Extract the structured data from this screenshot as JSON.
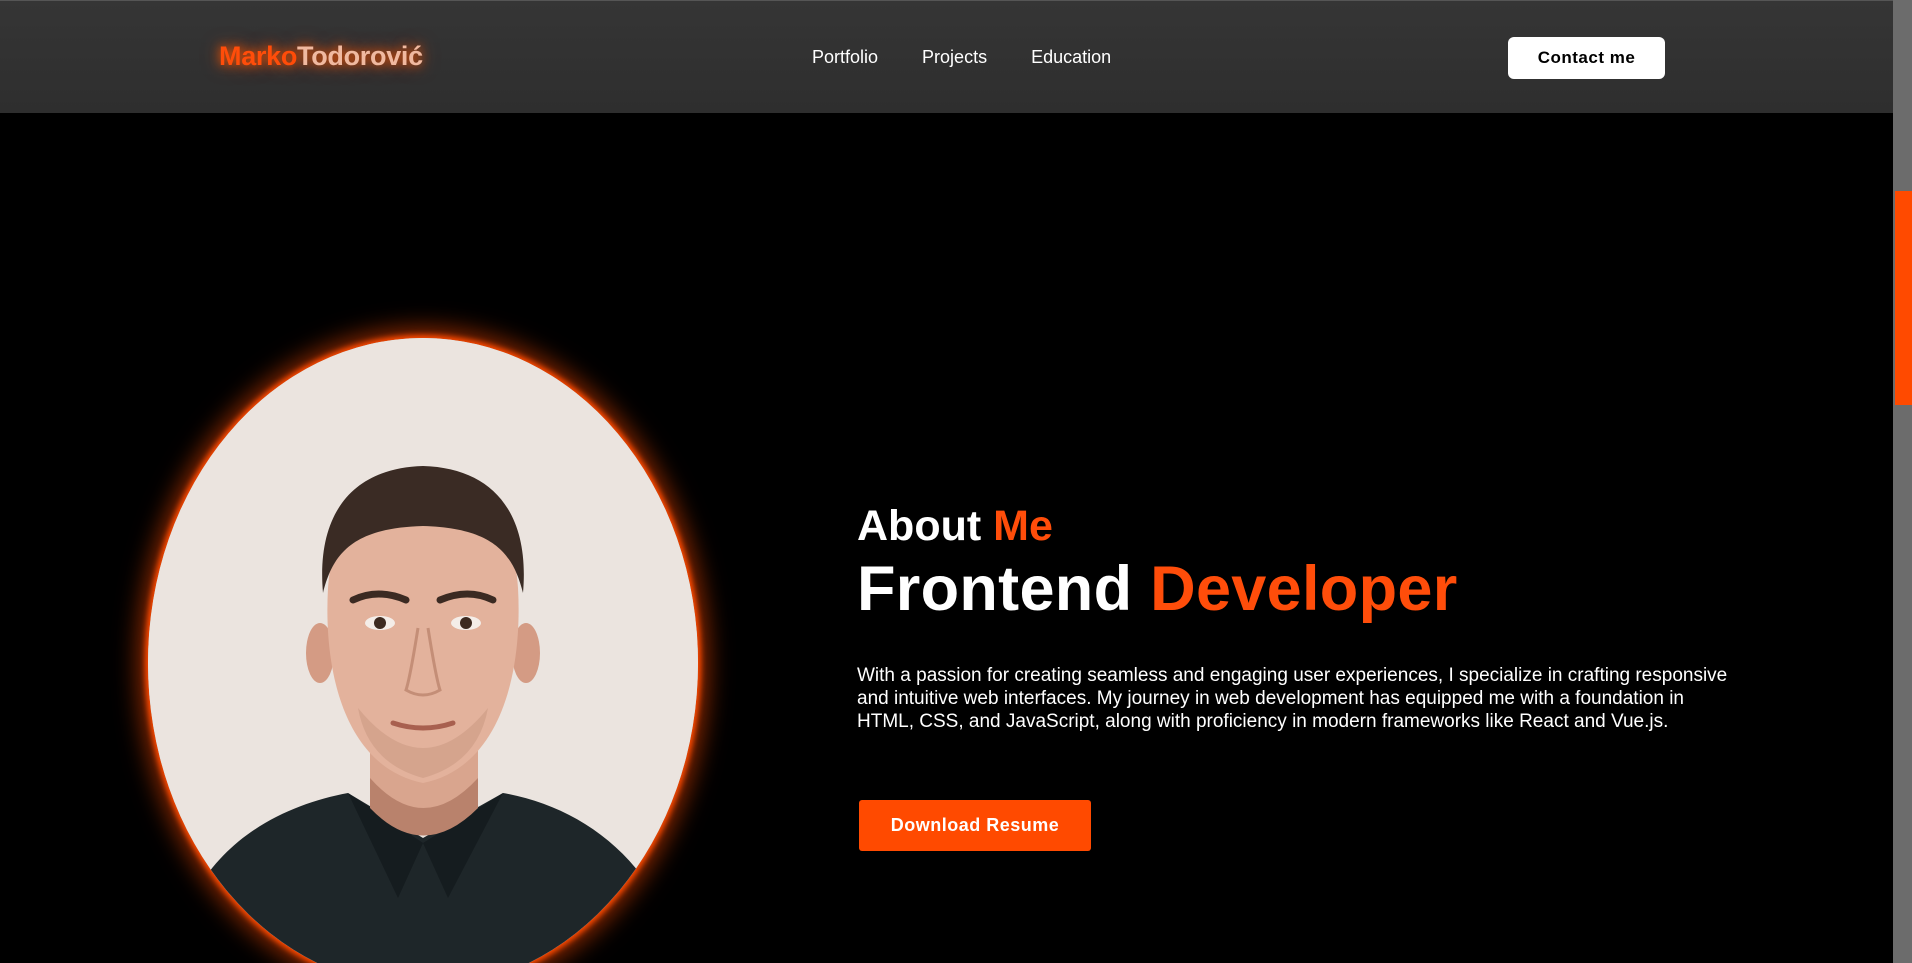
{
  "header": {
    "logo_first": "Marko",
    "logo_last": "Todorović",
    "nav": [
      {
        "label": "Portfolio"
      },
      {
        "label": "Projects"
      },
      {
        "label": "Education"
      }
    ],
    "contact_label": "Contact me"
  },
  "hero": {
    "about_word": "About",
    "about_accent": "Me",
    "role_word": "Frontend",
    "role_accent": "Developer",
    "bio": "With a passion for creating seamless and engaging user experiences, I specialize in crafting responsive and intuitive web interfaces. My journey in web development has equipped me with a foundation in HTML, CSS, and JavaScript, along with proficiency in modern frameworks like React and Vue.js.",
    "download_label": "Download Resume"
  },
  "colors": {
    "accent": "#ff4a00",
    "header_bg": "#333333",
    "page_bg": "#000000",
    "text": "#ffffff"
  },
  "icons": {
    "portrait": "profile-photo"
  }
}
